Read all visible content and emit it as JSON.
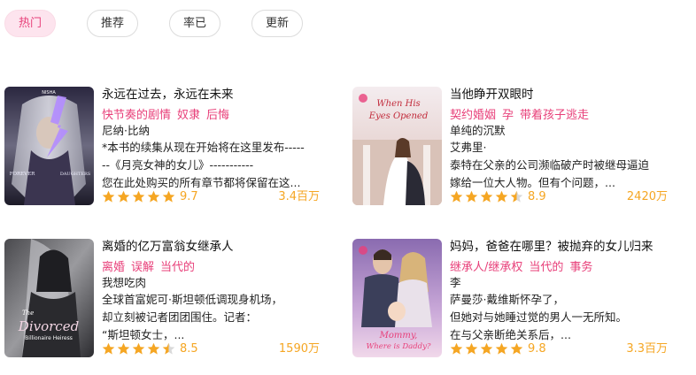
{
  "tabs": [
    {
      "label": "热门",
      "active": true
    },
    {
      "label": "推荐",
      "active": false
    },
    {
      "label": "率已",
      "active": false
    },
    {
      "label": "更新",
      "active": false
    }
  ],
  "colors": {
    "accent": "#e8407a",
    "star": "#f5a623",
    "star_empty": "#d9d9d9"
  },
  "books": [
    {
      "title": "永远在过去，永远在未来",
      "tags": [
        "快节奏的剧情",
        "奴隶",
        "后悔"
      ],
      "author": "尼纳·比纳",
      "desc": [
        "*本书的续集从现在开始将在这里发布-----",
        "--《月亮女神的女儿》-----------",
        "您在此处购买的所有章节都将保留在这..."
      ],
      "rating": "9.7",
      "stars": 5,
      "count": "3.4百万",
      "cover_text": [
        "NISHA",
        "FOREVER",
        "DAUGHTERS"
      ]
    },
    {
      "title": "当他睁开双眼时",
      "tags": [
        "契约婚姻",
        "孕",
        "带着孩子逃走"
      ],
      "author": "单纯的沉默",
      "desc": [
        "艾弗里·",
        "泰特在父亲的公司濒临破产时被继母逼迫",
        "嫁给一位大人物。但有个问题，..."
      ],
      "rating": "8.9",
      "stars": 4.5,
      "count": "2420万",
      "cover_text": [
        "When His",
        "Eyes Opened"
      ]
    },
    {
      "title": "离婚的亿万富翁女继承人",
      "tags": [
        "离婚",
        "误解",
        "当代的"
      ],
      "author": "我想吃肉",
      "desc": [
        "全球首富妮可·斯坦顿低调现身机场，",
        "却立刻被记者团团围住。记者：",
        "“斯坦顿女士，..."
      ],
      "rating": "8.5",
      "stars": 4.5,
      "count": "1590万",
      "cover_text": [
        "The",
        "Divorced",
        "Billionaire Heiress"
      ]
    },
    {
      "title": "妈妈，爸爸在哪里？被抛弃的女儿归来",
      "tags": [
        "继承人/继承权",
        "当代的",
        "事务"
      ],
      "author": "李",
      "desc": [
        "萨曼莎·戴维斯怀孕了，",
        "但她对与她睡过觉的男人一无所知。",
        "在与父亲断绝关系后，..."
      ],
      "rating": "9.8",
      "stars": 5,
      "count": "3.3百万",
      "cover_text": [
        "Mommy,",
        "Where is Daddy?"
      ]
    }
  ]
}
